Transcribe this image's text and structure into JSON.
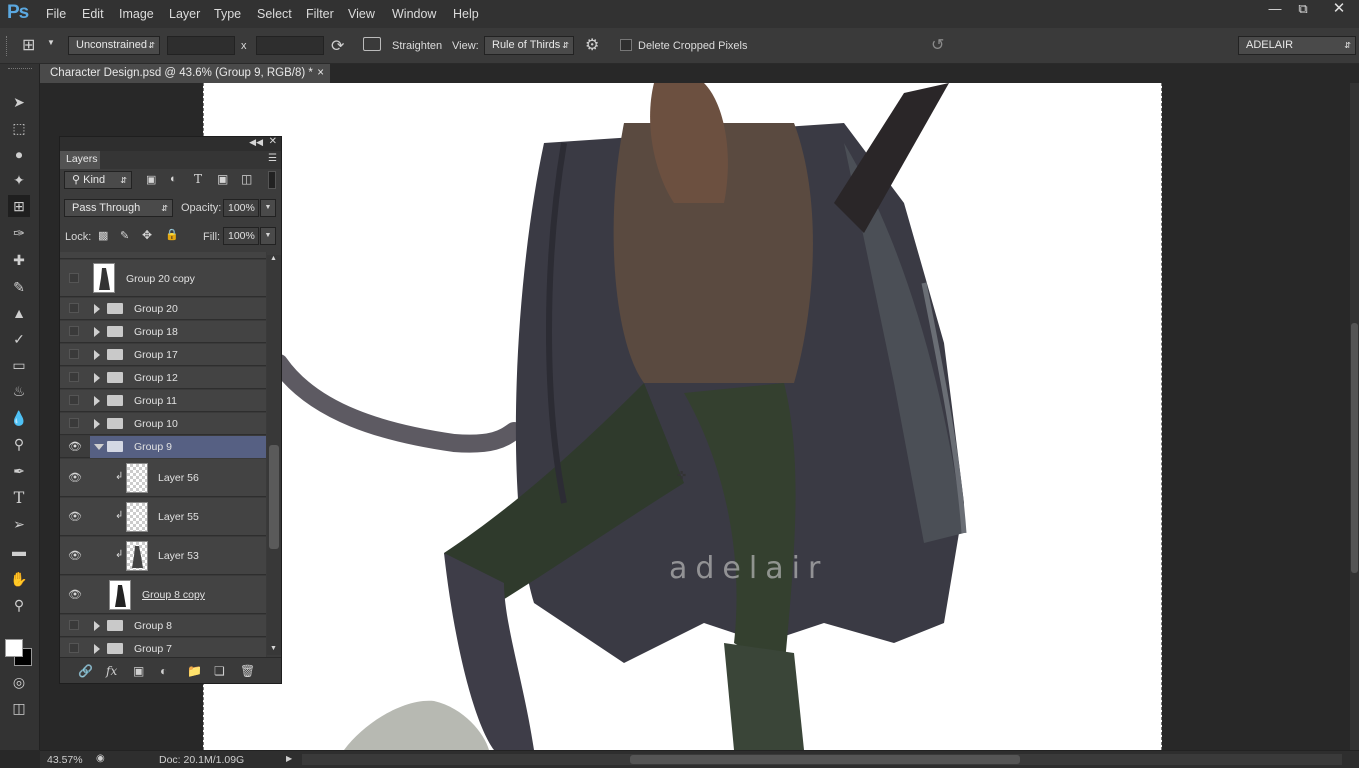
{
  "app": {
    "logo": "Ps"
  },
  "menu": [
    "File",
    "Edit",
    "Image",
    "Layer",
    "Type",
    "Select",
    "Filter",
    "View",
    "Window",
    "Help"
  ],
  "options": {
    "ratio": "Unconstrained",
    "x_label": "x",
    "straighten": "Straighten",
    "view_label": "View:",
    "view_value": "Rule of Thirds",
    "delete_cropped": "Delete Cropped Pixels",
    "workspace": "ADELAIR"
  },
  "document": {
    "tab_title": "Character Design.psd @ 43.6% (Group 9, RGB/8) *",
    "close": "×"
  },
  "canvas": {
    "watermark": "adelair"
  },
  "status": {
    "zoom": "43.57%",
    "doc": "Doc: 20.1M/1.09G"
  },
  "layers_panel": {
    "tab": "Layers",
    "filter_kind": "Kind",
    "blend_mode": "Pass Through",
    "opacity_label": "Opacity:",
    "opacity": "100%",
    "lock_label": "Lock:",
    "fill_label": "Fill:",
    "fill": "100%",
    "layers": [
      {
        "name": "Group 20 copy",
        "type": "layer",
        "visible": false
      },
      {
        "name": "Group 20",
        "type": "group",
        "visible": false
      },
      {
        "name": "Group 18",
        "type": "group",
        "visible": false
      },
      {
        "name": "Group 17",
        "type": "group",
        "visible": false
      },
      {
        "name": "Group 12",
        "type": "group",
        "visible": false
      },
      {
        "name": "Group 11",
        "type": "group",
        "visible": false
      },
      {
        "name": "Group 10",
        "type": "group",
        "visible": false
      },
      {
        "name": "Group 9",
        "type": "group-open",
        "visible": true
      },
      {
        "name": "Layer 56",
        "type": "clipped",
        "visible": true
      },
      {
        "name": "Layer 55",
        "type": "clipped",
        "visible": true
      },
      {
        "name": "Layer 53",
        "type": "clipped",
        "visible": true
      },
      {
        "name": "Group 8 copy",
        "type": "layer",
        "visible": true
      },
      {
        "name": "Group 8",
        "type": "group",
        "visible": false
      },
      {
        "name": "Group 7",
        "type": "group",
        "visible": false
      }
    ]
  },
  "colors": {
    "accent": "#566083",
    "menubar": "#323232",
    "panel": "#3c3c3c"
  }
}
